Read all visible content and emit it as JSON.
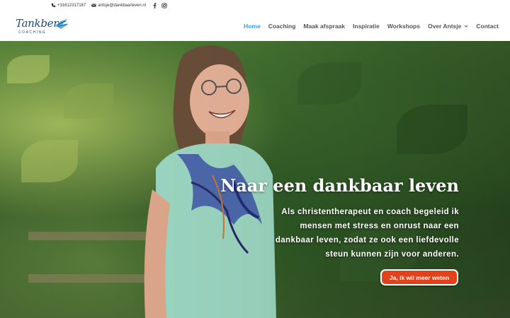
{
  "topbar": {
    "phone": "+31612317167",
    "email": "antsje@dankbaarleven.nl",
    "social": [
      "facebook-icon",
      "instagram-icon"
    ]
  },
  "logo": {
    "name": "Tankber",
    "sub": "COACHING"
  },
  "nav": {
    "items": [
      {
        "label": "Home",
        "active": true
      },
      {
        "label": "Coaching",
        "active": false
      },
      {
        "label": "Maak afspraak",
        "active": false
      },
      {
        "label": "Inspiratie",
        "active": false
      },
      {
        "label": "Workshops",
        "active": false
      },
      {
        "label": "Over Antsje",
        "active": false,
        "dropdown": true
      },
      {
        "label": "Contact",
        "active": false
      }
    ]
  },
  "hero": {
    "title": "Naar een dankbaar leven",
    "text": "Als christentherapeut en coach begeleid ik mensen met stress en onrust naar een dankbaar leven, zodat ze ook een liefdevolle steun kunnen zijn voor anderen.",
    "cta": "Ja, ik wil meer weten"
  },
  "colors": {
    "accent": "#2ea3f2",
    "cta": "#e0421c",
    "logo": "#1d4a82"
  }
}
